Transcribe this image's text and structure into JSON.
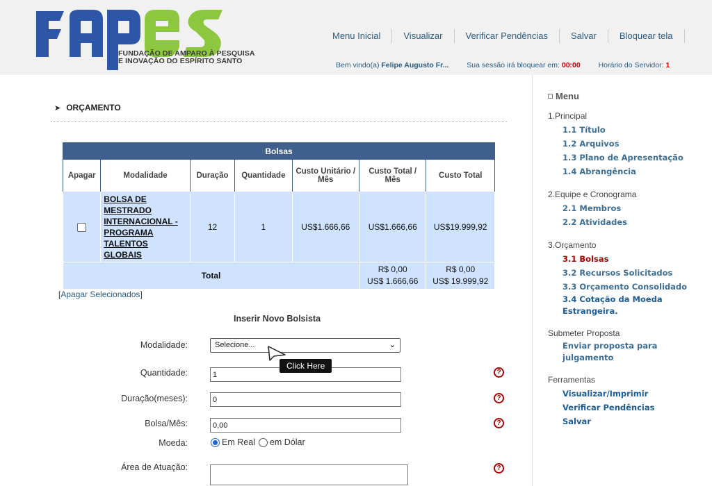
{
  "brand": {
    "logo_text": "FAPES",
    "subtitle_line1": "FUNDAÇÃO DE AMPARO À PESQUISA",
    "subtitle_line2": "E INOVAÇÃO DO ESPÍRITO SANTO",
    "colors": {
      "blue": "#2e56a6",
      "green": "#8dc63f"
    }
  },
  "nav": {
    "items": [
      "Menu Inicial",
      "Visualizar",
      "Verificar Pendências",
      "Salvar",
      "Bloquear tela"
    ]
  },
  "status": {
    "welcome": "Bem vindo(a)",
    "user": "Felipe Augusto Fr...",
    "session_label": "Sua sessão irá bloquear em:",
    "session_time": "00:00",
    "server_label": "Horário do Servidor:",
    "server_time": "1"
  },
  "section": {
    "title": "ORÇAMENTO"
  },
  "table": {
    "caption": "Bolsas",
    "headers": [
      "Apagar",
      "Modalidade",
      "Duração",
      "Quantidade",
      "Custo Unitário / Mês",
      "Custo Total / Mês",
      "Custo Total"
    ],
    "rows": [
      {
        "modalidade": "BOLSA DE MESTRADO INTERNACIONAL - PROGRAMA TALENTOS GLOBAIS",
        "duracao": "12",
        "quantidade": "1",
        "custo_unitario": "US$1.666,66",
        "custo_total_mes": "US$1.666,66",
        "custo_total": "US$19.999,92"
      }
    ],
    "total": {
      "label": "Total",
      "mes_brl": "R$ 0,00",
      "mes_usd": "US$ 1.666,66",
      "total_brl": "R$ 0,00",
      "total_usd": "US$ 19.999,92"
    },
    "delete_selected": "Apagar Selecionados"
  },
  "form": {
    "title": "Inserir Novo Bolsista",
    "modalidade_label": "Modalidade:",
    "modalidade_value": "Selecione...",
    "quantidade_label": "Quantidade:",
    "quantidade_value": "1",
    "duracao_label": "Duração(meses):",
    "duracao_value": "0",
    "bolsa_label": "Bolsa/Mês:",
    "bolsa_value": "0,00",
    "moeda_label": "Moeda:",
    "moeda_options": [
      "Em Real",
      "em Dólar"
    ],
    "moeda_selected": "Em Real",
    "area_label": "Área de Atuação:",
    "tooltip": "Click Here"
  },
  "menu": {
    "title": "Menu",
    "groups": [
      {
        "title": "1.Principal",
        "items": [
          "1.1 Título",
          "1.2 Arquivos",
          "1.3 Plano de Apresentação",
          "1.4 Abrangência"
        ]
      },
      {
        "title": "2.Equipe e Cronograma",
        "items": [
          "2.1 Membros",
          "2.2 Atividades"
        ]
      },
      {
        "title": "3.Orçamento",
        "items": [
          "3.1 Bolsas",
          "3.2 Recursos Solicitados",
          "3.3 Orçamento Consolidado",
          "3.4 Cotação da Moeda Estrangeira."
        ]
      },
      {
        "title": "Submeter Proposta",
        "items": [
          "Enviar proposta para julgamento"
        ]
      },
      {
        "title": "Ferramentas",
        "items": [
          "Visualizar/Imprimir",
          "Verificar Pendências",
          "Salvar"
        ]
      }
    ],
    "active_item": "3.1 Bolsas"
  }
}
